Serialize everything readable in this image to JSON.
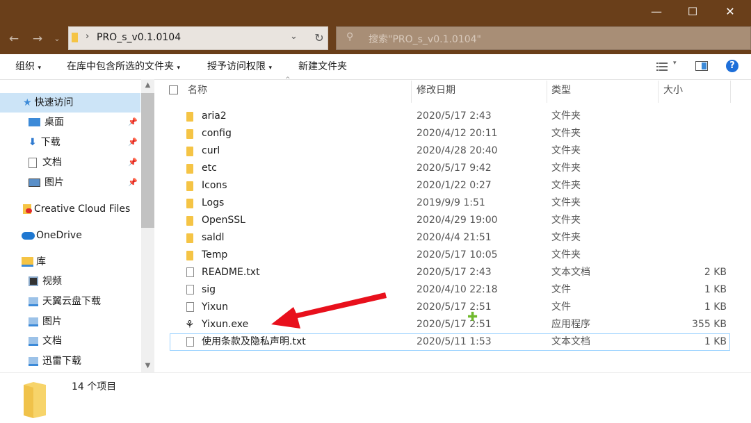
{
  "window": {
    "buttons": [
      "—",
      "☐",
      "✕"
    ]
  },
  "address": {
    "path": "PRO_s_v0.1.0104",
    "search_placeholder": "搜索\"PRO_s_v0.1.0104\""
  },
  "toolbar": {
    "organize": "组织",
    "include_in_library": "在库中包含所选的文件夹",
    "grant_access": "授予访问权限",
    "new_folder": "新建文件夹"
  },
  "sidebar": {
    "items": [
      {
        "label": "快速访问",
        "icon": "star-icon",
        "pinned": false,
        "level": 0
      },
      {
        "label": "桌面",
        "icon": "desktop-icon",
        "pinned": true,
        "level": 1
      },
      {
        "label": "下载",
        "icon": "download-icon",
        "pinned": true,
        "level": 1
      },
      {
        "label": "文档",
        "icon": "document-icon",
        "pinned": true,
        "level": 1
      },
      {
        "label": "图片",
        "icon": "picture-icon",
        "pinned": true,
        "level": 1
      },
      {
        "label": "Creative Cloud Files",
        "icon": "creative-cloud-icon",
        "pinned": false,
        "level": 0
      },
      {
        "label": "OneDrive",
        "icon": "cloud-icon",
        "pinned": false,
        "level": 0
      },
      {
        "label": "库",
        "icon": "library-icon",
        "pinned": false,
        "level": 0
      },
      {
        "label": "视频",
        "icon": "video-icon",
        "pinned": false,
        "level": 1
      },
      {
        "label": "天翼云盘下载",
        "icon": "download-icon",
        "pinned": false,
        "level": 1
      },
      {
        "label": "图片",
        "icon": "picture-icon",
        "pinned": false,
        "level": 1
      },
      {
        "label": "文档",
        "icon": "document-icon",
        "pinned": false,
        "level": 1
      },
      {
        "label": "迅雷下载",
        "icon": "download-icon",
        "pinned": false,
        "level": 1
      }
    ]
  },
  "columns": {
    "name": "名称",
    "date": "修改日期",
    "type": "类型",
    "size": "大小"
  },
  "files": [
    {
      "name": "aria2",
      "date": "2020/5/17 2:43",
      "type": "文件夹",
      "size": "",
      "icon": "folder-icon"
    },
    {
      "name": "config",
      "date": "2020/4/12 20:11",
      "type": "文件夹",
      "size": "",
      "icon": "folder-icon"
    },
    {
      "name": "curl",
      "date": "2020/4/28 20:40",
      "type": "文件夹",
      "size": "",
      "icon": "folder-icon"
    },
    {
      "name": "etc",
      "date": "2020/5/17 9:42",
      "type": "文件夹",
      "size": "",
      "icon": "folder-icon"
    },
    {
      "name": "Icons",
      "date": "2020/1/22 0:27",
      "type": "文件夹",
      "size": "",
      "icon": "folder-icon"
    },
    {
      "name": "Logs",
      "date": "2019/9/9 1:51",
      "type": "文件夹",
      "size": "",
      "icon": "folder-icon"
    },
    {
      "name": "OpenSSL",
      "date": "2020/4/29 19:00",
      "type": "文件夹",
      "size": "",
      "icon": "folder-icon"
    },
    {
      "name": "saldl",
      "date": "2020/4/4 21:51",
      "type": "文件夹",
      "size": "",
      "icon": "folder-icon"
    },
    {
      "name": "Temp",
      "date": "2020/5/17 10:05",
      "type": "文件夹",
      "size": "",
      "icon": "folder-icon"
    },
    {
      "name": "README.txt",
      "date": "2020/5/17 2:43",
      "type": "文本文档",
      "size": "2 KB",
      "icon": "text-file-icon"
    },
    {
      "name": "sig",
      "date": "2020/4/10 22:18",
      "type": "文件",
      "size": "1 KB",
      "icon": "file-icon"
    },
    {
      "name": "Yixun",
      "date": "2020/5/17 2:51",
      "type": "文件",
      "size": "1 KB",
      "icon": "file-icon"
    },
    {
      "name": "Yixun.exe",
      "date": "2020/5/17 2:51",
      "type": "应用程序",
      "size": "355 KB",
      "icon": "exe-icon"
    },
    {
      "name": "使用条款及隐私声明.txt",
      "date": "2020/5/11 1:53",
      "type": "文本文档",
      "size": "1 KB",
      "icon": "text-file-icon"
    }
  ],
  "status": {
    "item_count": "14 个项目"
  },
  "colors": {
    "titlebar": "#6a3f1a",
    "selection": "#cce4f7",
    "arrow": "#e8101c",
    "cursor": "#6fb92c"
  }
}
